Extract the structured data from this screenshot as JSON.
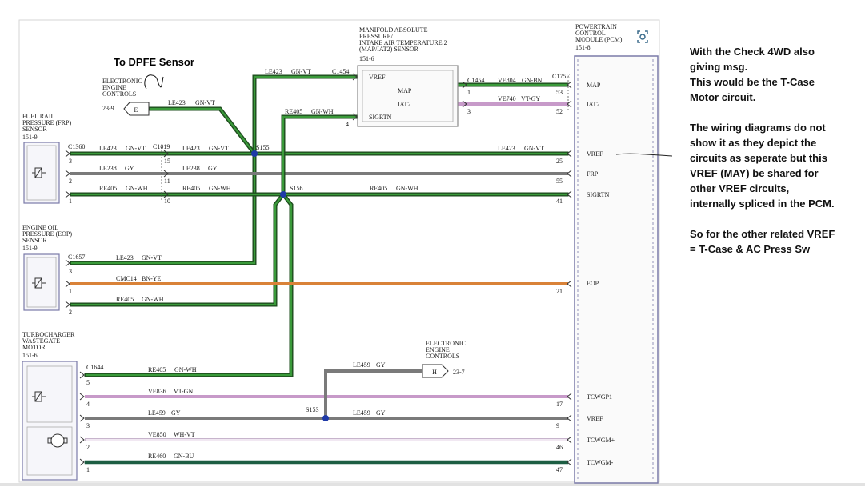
{
  "title": "To DPFE Sensor",
  "components": {
    "map_sensor": {
      "name_lines": [
        "MANIFOLD ABSOLUTE",
        "PRESSURE/",
        "INTAKE AIR TEMPERATURE 2",
        "(MAP/IAT2) SENSOR"
      ],
      "ref": "151-6",
      "pins": [
        "VREF",
        "MAP",
        "IAT2",
        "SIGRTN"
      ]
    },
    "eec_top": {
      "name_lines": [
        "ELECTRONIC",
        "ENGINE",
        "CONTROLS"
      ],
      "ref": "23-9",
      "pin": "E"
    },
    "frp_sensor": {
      "name_lines": [
        "FUEL RAIL",
        "PRESSURE (FRP)",
        "SENSOR"
      ],
      "ref": "151-9"
    },
    "eop_sensor": {
      "name_lines": [
        "ENGINE OIL",
        "PRESSURE (EOP)",
        "SENSOR"
      ],
      "ref": "151-9"
    },
    "turbo": {
      "name_lines": [
        "TURBOCHARGER",
        "WASTEGATE",
        "MOTOR"
      ],
      "ref": "151-6"
    },
    "eec_mid": {
      "name_lines": [
        "ELECTRONIC",
        "ENGINE",
        "CONTROLS"
      ],
      "ref": "23-7",
      "pin": "H"
    },
    "pcm": {
      "name_lines": [
        "POWERTRAIN",
        "CONTROL",
        "MODULE (PCM)"
      ],
      "ref": "151-8",
      "pins": [
        "MAP",
        "IAT2",
        "VREF",
        "FRP",
        "SIGRTN",
        "EOP",
        "TCWGP1",
        "VREF",
        "TCWGM+",
        "TCWGM-"
      ]
    }
  },
  "connectors": [
    "C1360",
    "C1019",
    "C1454",
    "C1454",
    "C175E",
    "C1657",
    "C1644"
  ],
  "splices": [
    "S155",
    "S156",
    "S153"
  ],
  "wires": [
    {
      "circuit": "LE423",
      "color": "GN-VT"
    },
    {
      "circuit": "LE423",
      "color": "GN-VT"
    },
    {
      "circuit": "LE423",
      "color": "GN-VT"
    },
    {
      "circuit": "LE423",
      "color": "GN-VT"
    },
    {
      "circuit": "LE423",
      "color": "GN-VT"
    },
    {
      "circuit": "LE423",
      "color": "GN-VT"
    },
    {
      "circuit": "LE238",
      "color": "GY"
    },
    {
      "circuit": "LE238",
      "color": "GY"
    },
    {
      "circuit": "RE405",
      "color": "GN-WH"
    },
    {
      "circuit": "RE405",
      "color": "GN-WH"
    },
    {
      "circuit": "RE405",
      "color": "GN-WH"
    },
    {
      "circuit": "RE405",
      "color": "GN-WH"
    },
    {
      "circuit": "RE405",
      "color": "GN-WH"
    },
    {
      "circuit": "RE405",
      "color": "GN-WH"
    },
    {
      "circuit": "VE804",
      "color": "GN-BN"
    },
    {
      "circuit": "VE740",
      "color": "VT-GY"
    },
    {
      "circuit": "CMC14",
      "color": "BN-YE"
    },
    {
      "circuit": "LE459",
      "color": "GY"
    },
    {
      "circuit": "LE459",
      "color": "GY"
    },
    {
      "circuit": "LE459",
      "color": "GY"
    },
    {
      "circuit": "VE836",
      "color": "VT-GN"
    },
    {
      "circuit": "VE850",
      "color": "WH-VT"
    },
    {
      "circuit": "RE460",
      "color": "GN-BU"
    }
  ],
  "pin_numbers": [
    "3",
    "2",
    "1",
    "15",
    "11",
    "10",
    "1",
    "3",
    "4",
    "53",
    "52",
    "25",
    "55",
    "41",
    "3",
    "1",
    "2",
    "21",
    "5",
    "4",
    "3",
    "2",
    "1",
    "17",
    "9",
    "46",
    "47"
  ],
  "notes": [
    "With the Check 4WD also",
    "giving msg.",
    "This would be the T-Case",
    "Motor circuit.",
    "",
    "The wiring diagrams do not",
    "show it as they depict the",
    "circuits as seperate but this",
    "VREF (MAY) be shared for",
    "other VREF circuits,",
    "internally spliced in the PCM.",
    "",
    "So for the other related VREF",
    "= T-Case & AC Press Sw"
  ],
  "colors": {
    "green": "#2f7d32",
    "gray": "#7a7a7a",
    "violet": "#c79ac9",
    "orange": "#d98238",
    "whvt": "#e3d7e6",
    "dkgreen": "#1d5e43",
    "pcm_border": "#7a7aa8"
  }
}
